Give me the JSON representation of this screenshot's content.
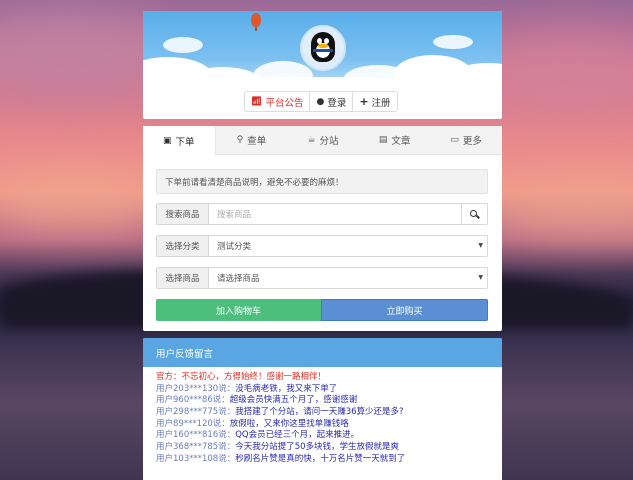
{
  "header": {
    "nav": [
      {
        "label": "平台公告",
        "icon": "wifi-icon"
      },
      {
        "label": "登录",
        "icon": "user-icon"
      },
      {
        "label": "注册",
        "icon": "plus-icon"
      }
    ]
  },
  "tabs": [
    {
      "label": "下单",
      "icon": "shopping-bag-icon",
      "active": true
    },
    {
      "label": "查单",
      "icon": "search-icon",
      "active": false
    },
    {
      "label": "分站",
      "icon": "coffee-icon",
      "active": false
    },
    {
      "label": "文章",
      "icon": "list-alt-icon",
      "active": false
    },
    {
      "label": "更多",
      "icon": "folder-open-icon",
      "active": false
    }
  ],
  "order": {
    "notice": "下单前请看清楚商品说明，避免不必要的麻烦！",
    "search_label": "搜索商品",
    "search_placeholder": "搜索商品",
    "category_label": "选择分类",
    "category_value": "测试分类",
    "product_label": "选择商品",
    "product_value": "请选择商品",
    "add_cart_label": "加入购物车",
    "buy_now_label": "立即购买"
  },
  "feedback": {
    "title": "用户反馈留言",
    "official": "官方：不忘初心，方得始终！感谢一路相伴！",
    "items": [
      {
        "user": "用户203***130说：",
        "msg": "没毛病老铁，我又来下单了"
      },
      {
        "user": "用户960***86说：",
        "msg": "超级会员快满五个月了，感谢感谢"
      },
      {
        "user": "用户298***775说：",
        "msg": "我搭建了个分站，请问一天赚36算少还是多?"
      },
      {
        "user": "用户89***120说：",
        "msg": "放假啦，又来你这里找单赚钱咯"
      },
      {
        "user": "用户160***816说：",
        "msg": "QQ会员已经三个月，起来推进。"
      },
      {
        "user": "用户368***785说：",
        "msg": "今天我分站提了50多块钱，学生放假就是爽"
      },
      {
        "user": "用户103***108说：",
        "msg": "秒刷名片赞是真的快，十万名片赞一天就到了"
      }
    ]
  },
  "colors": {
    "sky": "#59aeea",
    "add_cart": "#4cbf7d",
    "buy_now": "#5a8fd4",
    "feedback_header": "#5aa6e3",
    "official_text": "#e02a22"
  }
}
